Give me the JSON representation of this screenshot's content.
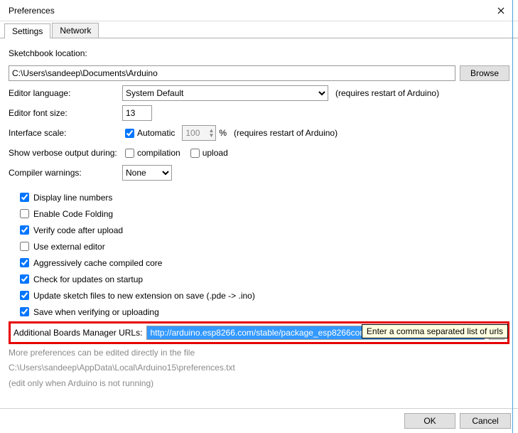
{
  "window": {
    "title": "Preferences"
  },
  "tabs": {
    "settings": "Settings",
    "network": "Network"
  },
  "sketchbook": {
    "label": "Sketchbook location:",
    "path": "C:\\Users\\sandeep\\Documents\\Arduino",
    "browse": "Browse"
  },
  "language": {
    "label": "Editor language:",
    "value": "System Default",
    "hint": "(requires restart of Arduino)"
  },
  "fontsize": {
    "label": "Editor font size:",
    "value": "13"
  },
  "scale": {
    "label": "Interface scale:",
    "auto_label": "Automatic",
    "auto_checked": true,
    "value": "100",
    "percent": "%",
    "hint": "(requires restart of Arduino)"
  },
  "verbose": {
    "label": "Show verbose output during:",
    "compilation_label": "compilation",
    "compilation_checked": false,
    "upload_label": "upload",
    "upload_checked": false
  },
  "warnings": {
    "label": "Compiler warnings:",
    "value": "None"
  },
  "checks": {
    "line_numbers": {
      "label": "Display line numbers",
      "checked": true
    },
    "code_folding": {
      "label": "Enable Code Folding",
      "checked": false
    },
    "verify_upload": {
      "label": "Verify code after upload",
      "checked": true
    },
    "external_editor": {
      "label": "Use external editor",
      "checked": false
    },
    "cache_core": {
      "label": "Aggressively cache compiled core",
      "checked": true
    },
    "check_updates": {
      "label": "Check for updates on startup",
      "checked": true
    },
    "update_ext": {
      "label": "Update sketch files to new extension on save (.pde -> .ino)",
      "checked": true
    },
    "save_verify": {
      "label": "Save when verifying or uploading",
      "checked": true
    }
  },
  "boards": {
    "label": "Additional Boards Manager URLs:",
    "value": "http://arduino.esp8266.com/stable/package_esp8266com_index.json",
    "tooltip": "Enter a comma separated list of urls"
  },
  "more": {
    "line1": "More preferences can be edited directly in the file",
    "path": "C:\\Users\\sandeep\\AppData\\Local\\Arduino15\\preferences.txt",
    "line3": "(edit only when Arduino is not running)"
  },
  "footer": {
    "ok": "OK",
    "cancel": "Cancel"
  }
}
